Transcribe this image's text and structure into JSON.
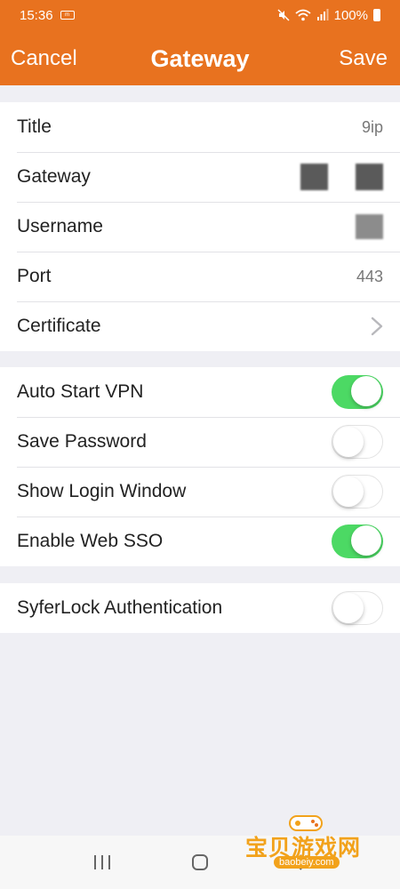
{
  "status_bar": {
    "time": "15:36",
    "battery": "100%",
    "icons": [
      "mute-icon",
      "wifi-icon",
      "signal-icon",
      "battery-icon"
    ]
  },
  "header": {
    "cancel_label": "Cancel",
    "title": "Gateway",
    "save_label": "Save",
    "background_color": "#e8721f"
  },
  "details": {
    "title_label": "Title",
    "title_value": "9ip",
    "gateway_label": "Gateway",
    "username_label": "Username",
    "port_label": "Port",
    "port_value": "443",
    "certificate_label": "Certificate"
  },
  "options": {
    "auto_start_vpn": {
      "label": "Auto Start VPN",
      "on": true
    },
    "save_password": {
      "label": "Save Password",
      "on": false
    },
    "show_login_window": {
      "label": "Show Login Window",
      "on": false
    },
    "enable_web_sso": {
      "label": "Enable Web SSO",
      "on": true
    }
  },
  "auth": {
    "syferlock": {
      "label": "SyferLock Authentication",
      "on": false
    }
  },
  "toggle_on_color": "#4cd964",
  "watermark": {
    "text": "宝贝游戏网",
    "sub": "baobeiy.com"
  }
}
